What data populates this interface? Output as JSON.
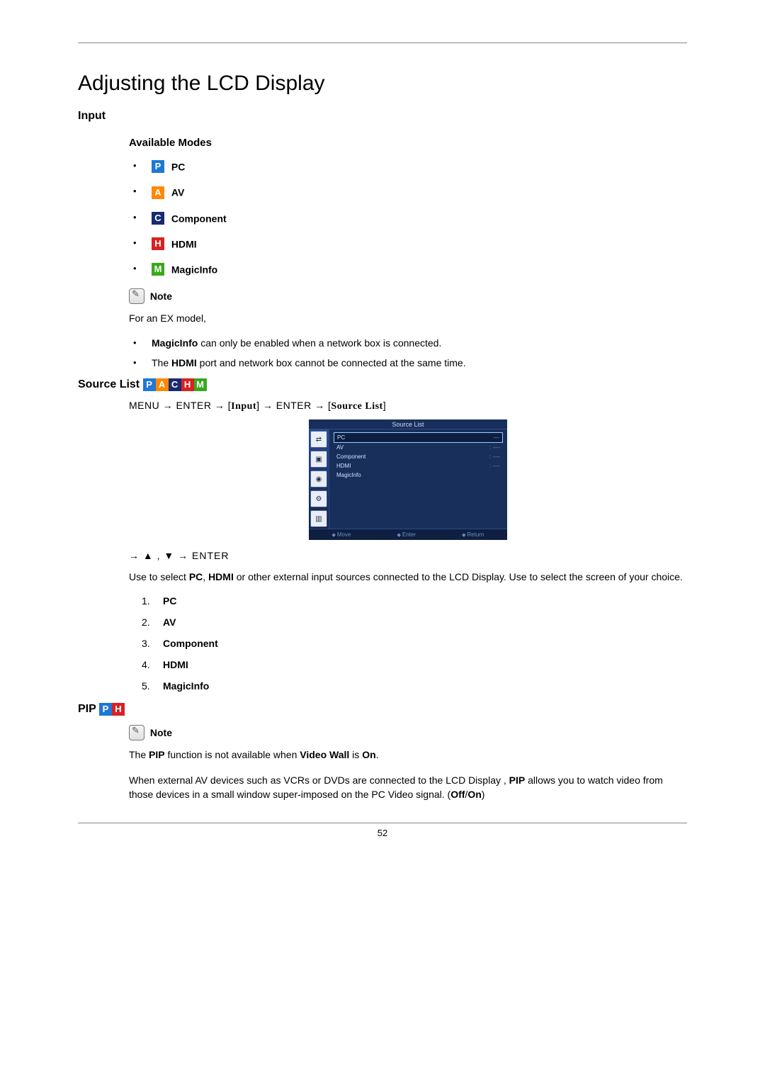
{
  "page": {
    "title": "Adjusting the LCD Display",
    "number": "52"
  },
  "input": {
    "heading": "Input",
    "available_modes_heading": "Available Modes",
    "modes": {
      "pc": {
        "letter": "P",
        "label": "PC"
      },
      "av": {
        "letter": "A",
        "label": "AV"
      },
      "component": {
        "letter": "C",
        "label": "Component"
      },
      "hdmi": {
        "letter": "H",
        "label": "HDMI"
      },
      "magicinfo": {
        "letter": "M",
        "label": "MagicInfo"
      }
    },
    "note_label": "Note",
    "note_intro": "For an EX model,",
    "note_points": [
      {
        "bold": "MagicInfo",
        "rest": " can only be enabled when a network box is connected."
      },
      {
        "pre": "The ",
        "bold": "HDMI",
        "rest": " port and network box cannot be connected at the same time."
      }
    ]
  },
  "source_list": {
    "heading": "Source List",
    "menu_path": {
      "menu": "MENU",
      "arrow": "→",
      "enter": "ENTER",
      "input": "Input",
      "source_list": "Source List"
    },
    "osd": {
      "title": "Source List",
      "rows": [
        {
          "name": "PC",
          "value": "—",
          "selected": true
        },
        {
          "name": "AV",
          "value": ": ----"
        },
        {
          "name": "Component",
          "value": ": ----"
        },
        {
          "name": "HDMI",
          "value": ": ----"
        },
        {
          "name": "MagicInfo",
          "value": ""
        }
      ],
      "bottom": [
        "Move",
        "Enter",
        "Return"
      ]
    },
    "nav_keys": "→ ▲ , ▼ → ENTER",
    "description_pre": "Use to select ",
    "desc_pc": "PC",
    "desc_mid1": ", ",
    "desc_hdmi": "HDMI",
    "description_post": " or other external input sources connected to the LCD Display. Use to select the screen of your choice.",
    "options": [
      "PC",
      "AV",
      "Component",
      "HDMI",
      "MagicInfo"
    ]
  },
  "pip": {
    "heading": "PIP",
    "note_label": "Note",
    "note1_pre": "The ",
    "note1_b1": "PIP",
    "note1_mid": " function is not available when ",
    "note1_b2": "Video Wall",
    "note1_mid2": " is ",
    "note1_b3": "On",
    "note1_end": ".",
    "note2": "When external AV devices such as VCRs or DVDs are connected to the LCD Display , ",
    "note2_b": "PIP",
    "note2_mid": " allows you to watch video from those devices in a small window super-imposed on the PC Video signal. (",
    "note2_b2": "Off",
    "note2_slash": "/",
    "note2_b3": "On",
    "note2_end": ")"
  }
}
